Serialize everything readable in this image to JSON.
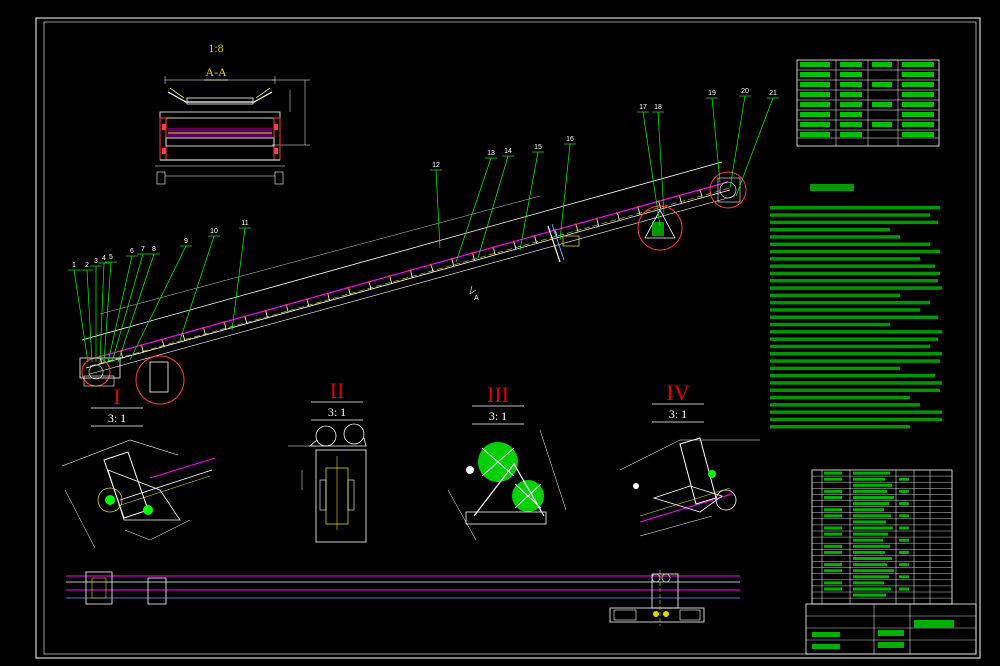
{
  "drawing": {
    "section_scale": "1:8",
    "section_name": "A-A",
    "balloons": [
      "1",
      "2",
      "3",
      "4",
      "5",
      "6",
      "7",
      "8",
      "9",
      "10",
      "11",
      "12",
      "13",
      "14",
      "15",
      "16",
      "17",
      "18",
      "19",
      "20",
      "21"
    ],
    "details": [
      {
        "roman": "I",
        "scale": "3: 1"
      },
      {
        "roman": "II",
        "scale": "3: 1"
      },
      {
        "roman": "III",
        "scale": "3: 1"
      },
      {
        "roman": "IV",
        "scale": "3: 1"
      }
    ]
  },
  "colors": {
    "background": "#000000",
    "frame": "#ffffff",
    "leader": "#00ff00",
    "belt": "#ff00ff",
    "centerline": "#ffff00",
    "structure": "#ffffff",
    "marker": "#ff0000"
  }
}
